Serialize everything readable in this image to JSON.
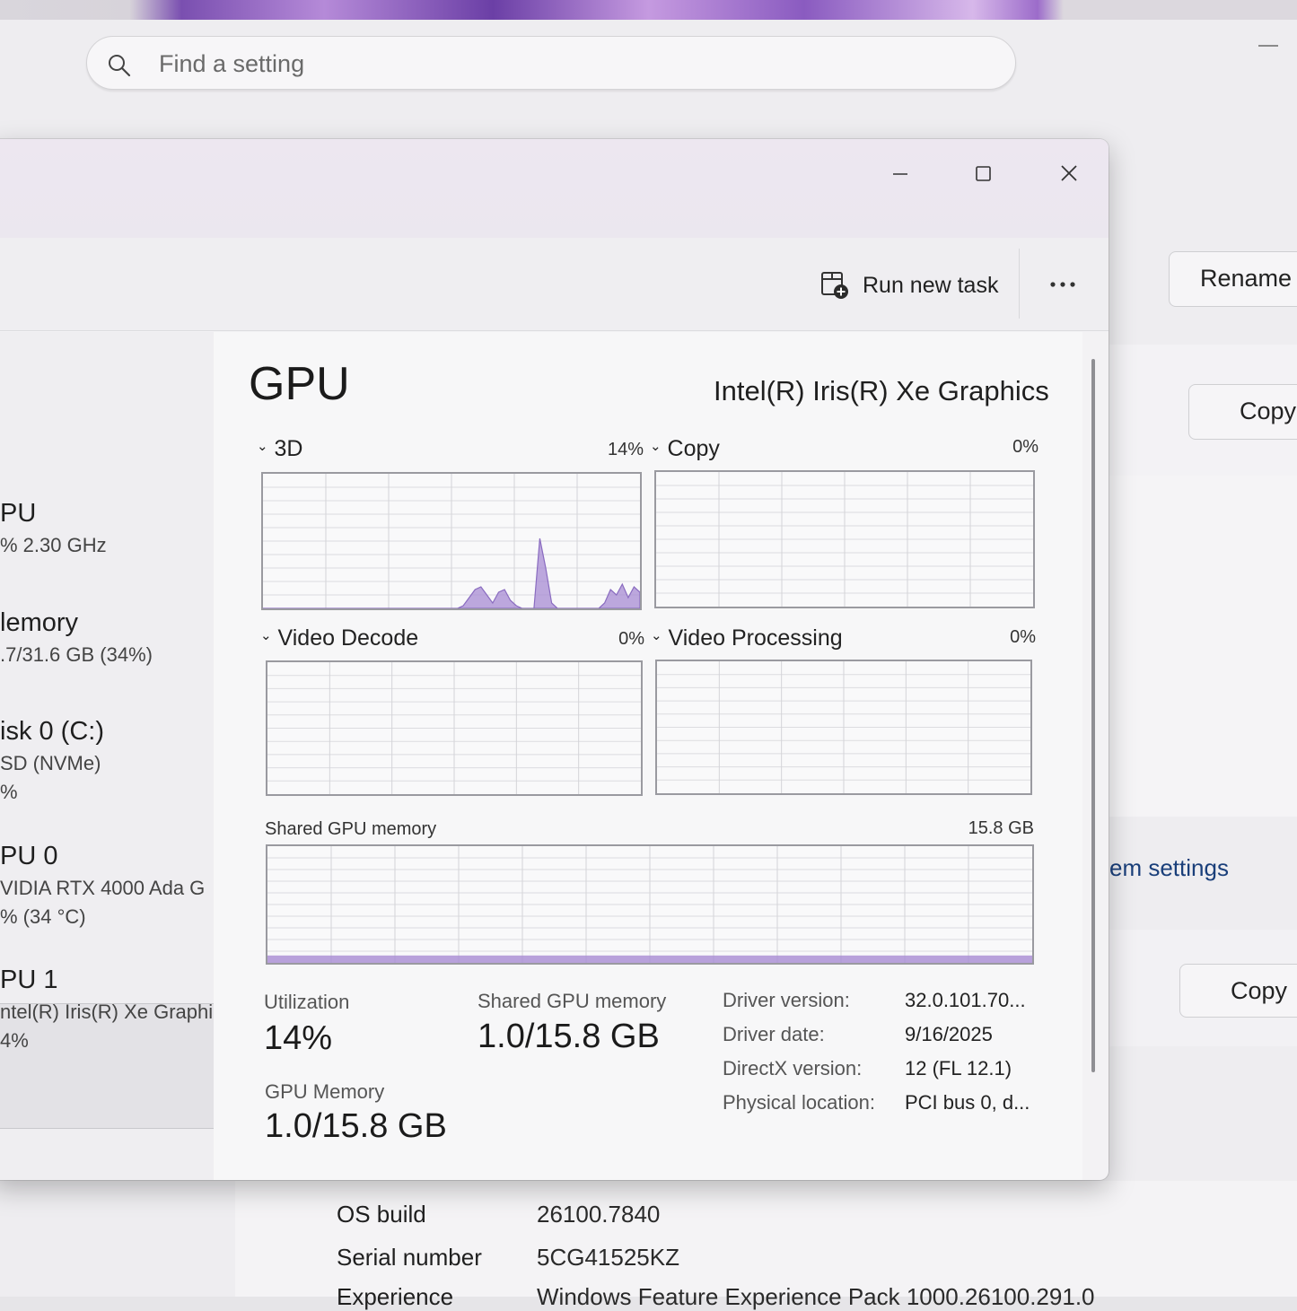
{
  "settings": {
    "search_placeholder": "Find a setting",
    "rename_label": "Rename",
    "copy_label_1": "Copy",
    "copy_label_2": "Copy",
    "system_settings_link": "em settings",
    "specs": [
      {
        "label": "OS build",
        "value": "26100.7840"
      },
      {
        "label": "Serial number",
        "value": "5CG41525KZ"
      },
      {
        "label": "Experience",
        "value": "Windows Feature Experience Pack 1000.26100.291.0"
      }
    ]
  },
  "task_manager": {
    "command_bar": {
      "run_new_task": "Run new task"
    },
    "sidebar": [
      {
        "title": "PU",
        "lines": [
          "%  2.30 GHz"
        ]
      },
      {
        "title": "lemory",
        "lines": [
          ".7/31.6 GB (34%)"
        ]
      },
      {
        "title": "isk 0 (C:)",
        "lines": [
          "SD (NVMe)",
          "%"
        ]
      },
      {
        "title": "PU 0",
        "lines": [
          "VIDIA RTX 4000 Ada G",
          "%  (34 °C)"
        ]
      },
      {
        "title": "PU 1",
        "lines": [
          "ntel(R) Iris(R) Xe Graphi",
          "4%"
        ],
        "selected": true
      }
    ],
    "gpu": {
      "title": "GPU",
      "adapter_name": "Intel(R) Iris(R) Xe Graphics",
      "engines": [
        {
          "name": "3D",
          "percent": "14%"
        },
        {
          "name": "Copy",
          "percent": "0%"
        },
        {
          "name": "Video Decode",
          "percent": "0%"
        },
        {
          "name": "Video Processing",
          "percent": "0%"
        }
      ],
      "shared_memory_graph": {
        "label": "Shared GPU memory",
        "max": "15.8 GB"
      },
      "stats": {
        "utilization_label": "Utilization",
        "utilization_value": "14%",
        "shared_gpu_memory_label": "Shared GPU memory",
        "shared_gpu_memory_value": "1.0/15.8 GB",
        "gpu_memory_label": "GPU Memory",
        "gpu_memory_value": "1.0/15.8 GB"
      },
      "info": [
        {
          "label": "Driver version:",
          "value": "32.0.101.70..."
        },
        {
          "label": "Driver date:",
          "value": "9/16/2025"
        },
        {
          "label": "DirectX version:",
          "value": "12 (FL 12.1)"
        },
        {
          "label": "Physical location:",
          "value": "PCI bus 0, d..."
        }
      ]
    },
    "chart_data": {
      "type": "area",
      "series": [
        {
          "name": "3D",
          "values": [
            0,
            0,
            0,
            0,
            0,
            0,
            0,
            0,
            0,
            0,
            0,
            0,
            0,
            0,
            0,
            0,
            0,
            0,
            0,
            0,
            0,
            0,
            0,
            0,
            0,
            0,
            0,
            0,
            0,
            0,
            0,
            0,
            0,
            0,
            2,
            8,
            14,
            16,
            10,
            4,
            12,
            14,
            6,
            2,
            0,
            0,
            0,
            52,
            30,
            4,
            0,
            0,
            0,
            0,
            0,
            0,
            0,
            0,
            4,
            14,
            10,
            18,
            8,
            16,
            12
          ]
        },
        {
          "name": "Copy",
          "values": [
            0
          ]
        },
        {
          "name": "Video Decode",
          "values": [
            0
          ]
        },
        {
          "name": "Video Processing",
          "values": [
            0
          ]
        }
      ],
      "shared_memory_fraction": 0.063,
      "accent": "#a78bd3"
    }
  }
}
